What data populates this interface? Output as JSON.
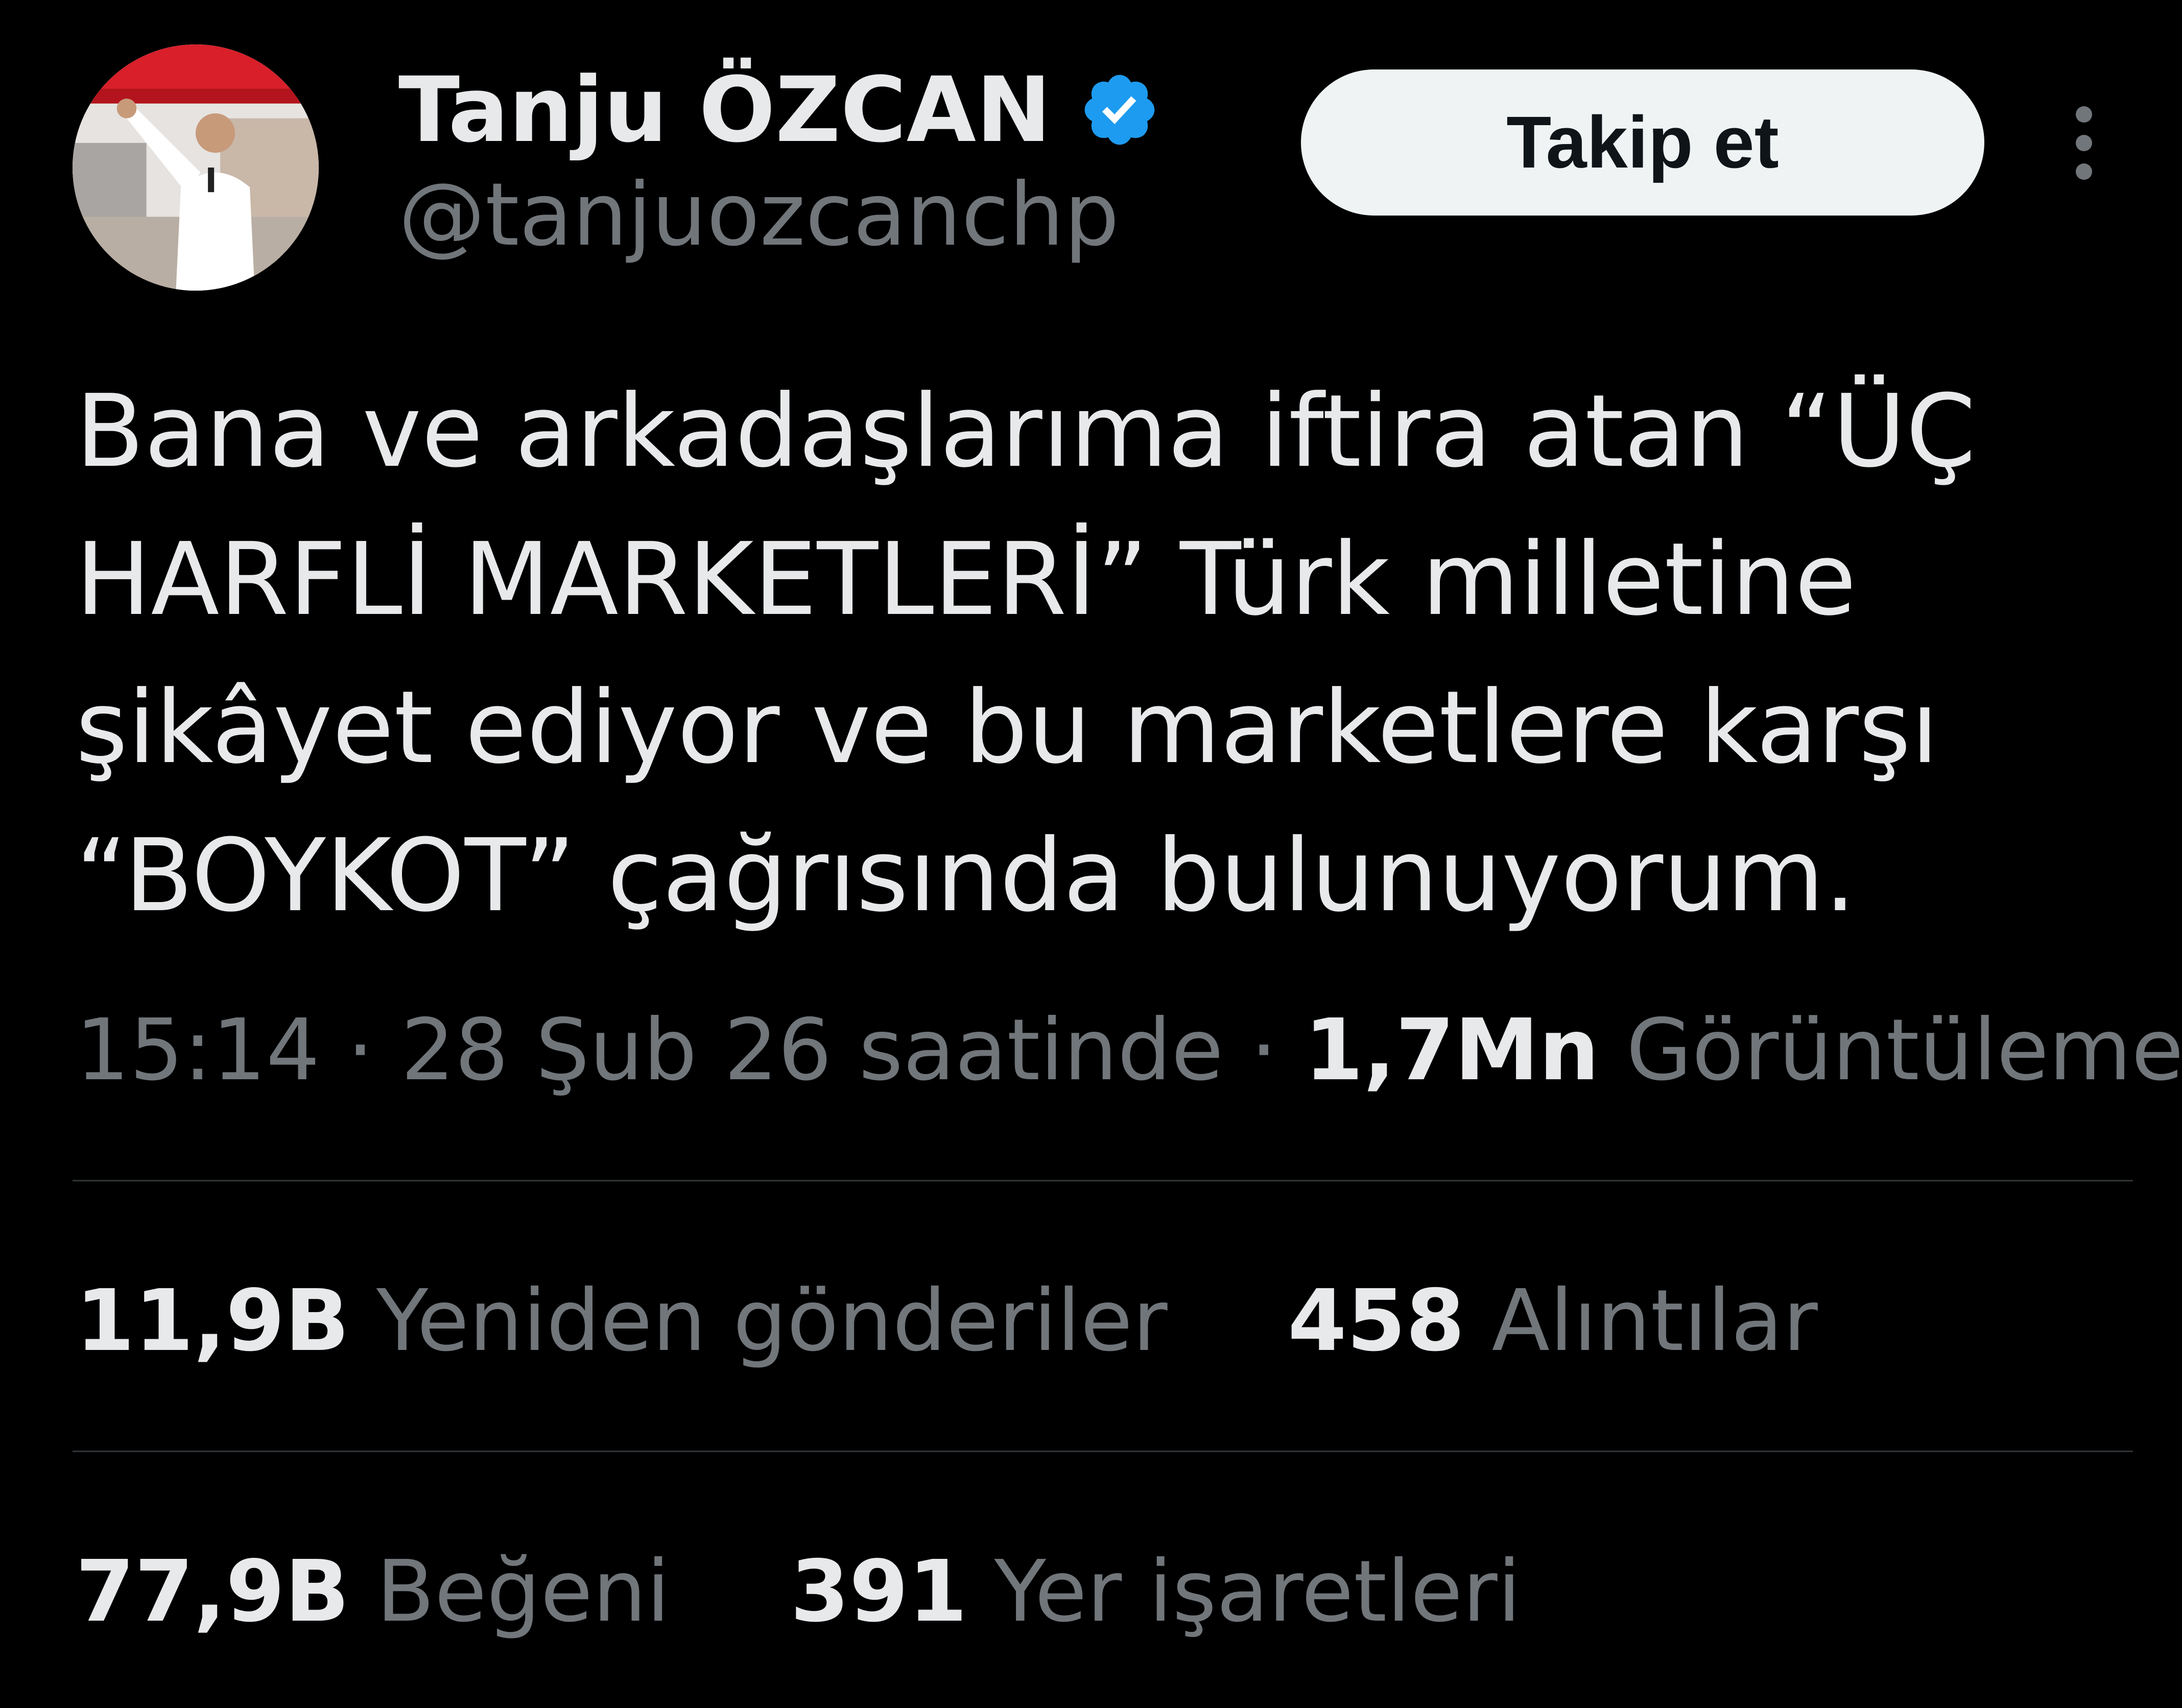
{
  "author": {
    "display_name": "Tanju ÖZCAN",
    "handle": "@tanjuozcanchp",
    "verified": true,
    "verified_color": "#1d9bf0"
  },
  "follow_button": {
    "label": "Takip et"
  },
  "tweet": {
    "text": "Bana ve arkadaşlarıma iftira atan “ÜÇ\nHARFLİ MARKETLERİ” Türk milletine\nşikâyet ediyor ve bu marketlere karşı\n“BOYKOT” çağrısında bulunuyorum."
  },
  "meta": {
    "time": "15:14",
    "separator": "·",
    "date": "28 Şub 26 saatinde",
    "views_value": "1,7Mn",
    "views_label": "Görüntüleme"
  },
  "stats": {
    "retweets": {
      "value": "11,9B",
      "label": "Yeniden gönderiler"
    },
    "quotes": {
      "value": "458",
      "label": "Alıntılar"
    },
    "likes": {
      "value": "77,9B",
      "label": "Beğeni"
    },
    "bookmarks": {
      "value": "391",
      "label": "Yer işaretleri"
    }
  },
  "colors": {
    "background": "#000000",
    "primary_text": "#e7e9ea",
    "secondary_text": "#71767b",
    "divider": "#2f3336",
    "button_bg": "#eff3f4"
  }
}
